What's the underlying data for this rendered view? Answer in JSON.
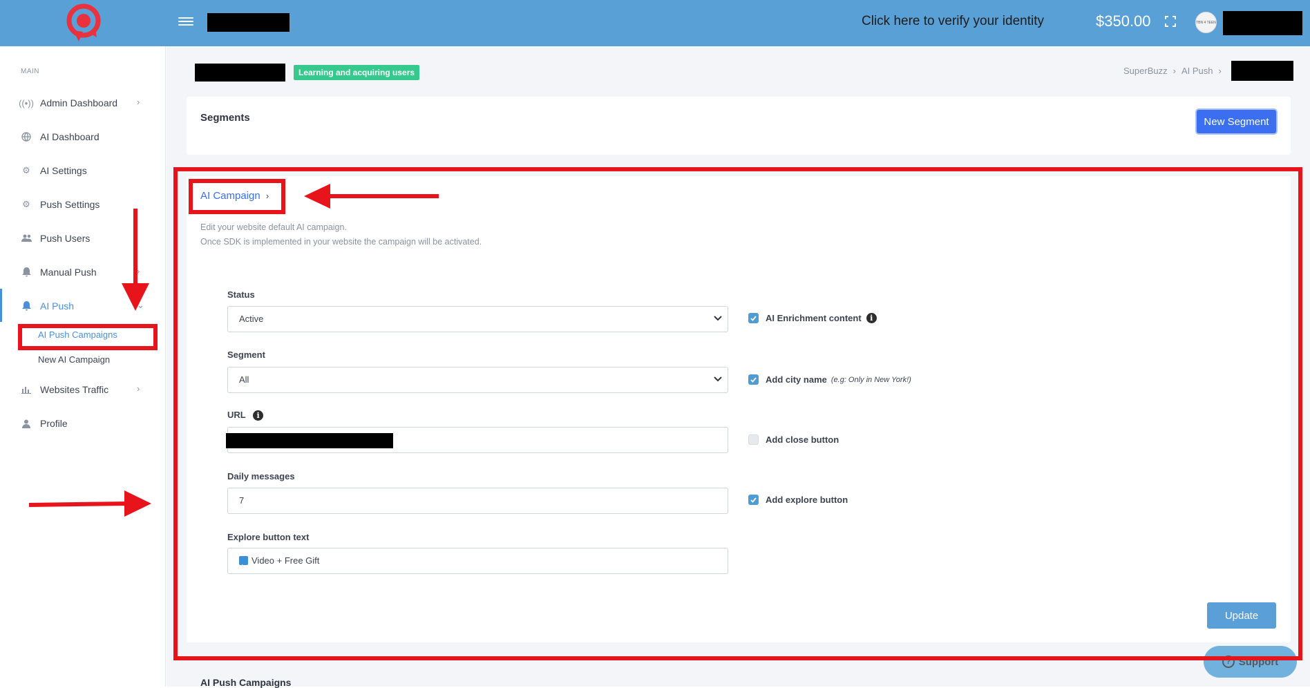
{
  "header": {
    "verify_text": "Click here to verify your identity",
    "balance": "$350.00",
    "avatar_text": "TBN 4 TEEN"
  },
  "sidebar": {
    "section_label": "MAIN",
    "items": [
      {
        "label": "Admin Dashboard",
        "icon": "broadcast-icon"
      },
      {
        "label": "AI Dashboard",
        "icon": "globe-icon"
      },
      {
        "label": "AI Settings",
        "icon": "gear-icon"
      },
      {
        "label": "Push Settings",
        "icon": "gear-icon"
      },
      {
        "label": "Push Users",
        "icon": "users-icon"
      },
      {
        "label": "Manual Push",
        "icon": "bell-icon"
      },
      {
        "label": "AI Push",
        "icon": "bell-icon"
      },
      {
        "label": "Websites Traffic",
        "icon": "bar-chart-icon"
      },
      {
        "label": "Profile",
        "icon": "user-icon"
      }
    ],
    "sub_items": [
      {
        "label": "AI Push Campaigns"
      },
      {
        "label": "New AI Campaign"
      }
    ]
  },
  "page": {
    "tag": "Learning and acquiring users",
    "breadcrumb": [
      "SuperBuzz",
      "AI Push"
    ]
  },
  "segments": {
    "title": "Segments",
    "new_button": "New Segment"
  },
  "ai_campaign": {
    "title": "AI Campaign",
    "desc_line1": "Edit your website default AI campaign.",
    "desc_line2": "Once SDK is implemented in your website the campaign will be activated.",
    "status_label": "Status",
    "status_value": "Active",
    "segment_label": "Segment",
    "segment_value": "All",
    "url_label": "URL",
    "daily_label": "Daily messages",
    "daily_value": "7",
    "explore_label": "Explore button text",
    "explore_value": "Video + Free Gift",
    "checks": [
      {
        "label": "AI Enrichment content",
        "checked": true
      },
      {
        "label": "Add city name",
        "hint": "(e.g: Only in New York!)",
        "checked": true
      },
      {
        "label": "Add close button",
        "checked": false
      },
      {
        "label": "Add explore button",
        "checked": true
      }
    ],
    "update_button": "Update"
  },
  "bottom": {
    "section_title": "AI Push Campaigns",
    "support_label": "Support"
  },
  "colors": {
    "topbar": "#58a0d6",
    "accent": "#3b6ef0",
    "annotation": "#e8141b",
    "tag": "#36c98d"
  }
}
